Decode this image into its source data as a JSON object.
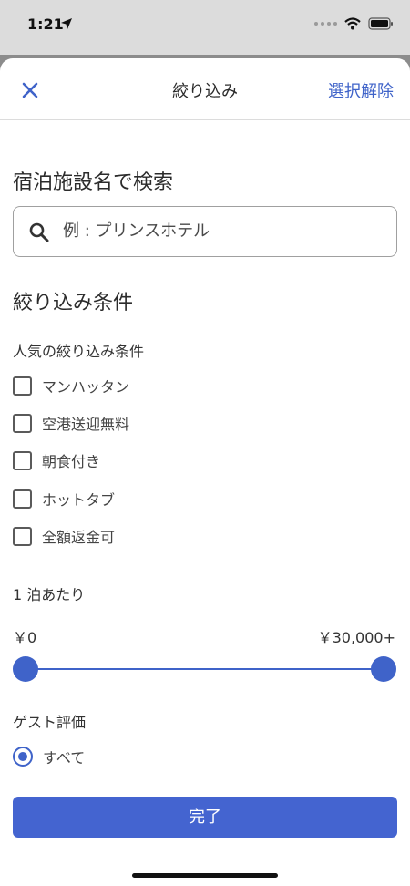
{
  "status_bar": {
    "time": "1:21"
  },
  "nav": {
    "title": "絞り込み",
    "clear_label": "選択解除"
  },
  "search": {
    "title": "宿泊施設名で検索",
    "placeholder": "例 : プリンスホテル"
  },
  "filters": {
    "title": "絞り込み条件",
    "popular_heading": "人気の絞り込み条件",
    "items": [
      {
        "label": "マンハッタン",
        "checked": false
      },
      {
        "label": "空港送迎無料",
        "checked": false
      },
      {
        "label": "朝食付き",
        "checked": false
      },
      {
        "label": "ホットタブ",
        "checked": false
      },
      {
        "label": "全額返金可",
        "checked": false
      }
    ]
  },
  "price": {
    "heading": "1 泊あたり",
    "min_label": "￥0",
    "max_label": "￥30,000+",
    "min_fraction": 0,
    "max_fraction": 1
  },
  "guest_rating": {
    "heading": "ゲスト評価",
    "options": [
      {
        "label": "すべて",
        "selected": true
      }
    ]
  },
  "done_label": "完了",
  "colors": {
    "accent": "#3f63c9",
    "button": "#4464d0"
  }
}
